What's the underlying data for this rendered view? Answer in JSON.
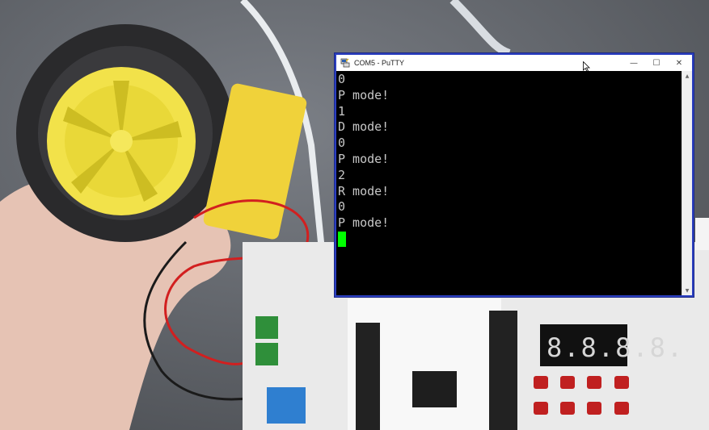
{
  "window": {
    "title": "COM5 - PuTTY",
    "controls": {
      "minimize": "—",
      "maximize": "☐",
      "close": "✕"
    },
    "icon": "putty-icon",
    "border_color": "#2b3fbf"
  },
  "terminal": {
    "lines": [
      "0",
      "P mode!",
      "1",
      "D mode!",
      "0",
      "P mode!",
      "2",
      "R mode!",
      "0",
      "P mode!"
    ],
    "text_color": "#c7c7c7",
    "background_color": "#000000",
    "cursor_color": "#00ff00"
  },
  "scrollbar": {
    "up_arrow": "▲",
    "down_arrow": "▼"
  },
  "background_photo": {
    "description_icons": [
      "wheel",
      "motor",
      "hand",
      "dev-board",
      "seven-segment-display"
    ],
    "display_digits": "8.8.8.8."
  }
}
